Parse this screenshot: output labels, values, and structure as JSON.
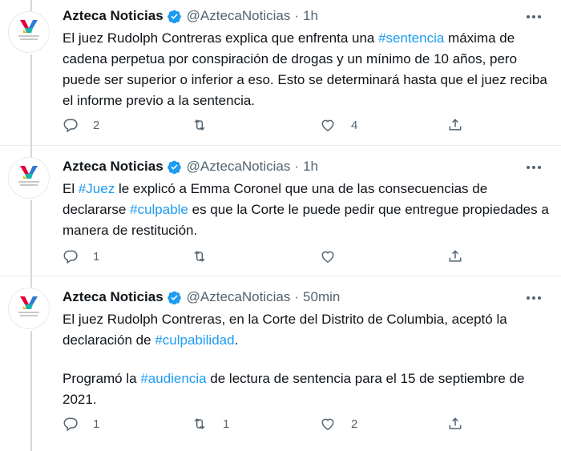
{
  "account": {
    "name": "Azteca Noticias",
    "handle": "@AztecaNoticias",
    "avatar_text": "tv azteca noticias",
    "brand_colors": [
      "#e5003b",
      "#2e7ad1",
      "#f5b400",
      "#19b3a7"
    ],
    "link_color": "#1d9bf0",
    "verified_color": "#1d9bf0"
  },
  "separator": "·",
  "tweets": [
    {
      "time": "1h",
      "segments": [
        {
          "t": "El juez Rudolph Contreras explica que enfrenta una "
        },
        {
          "t": "#sentencia",
          "tag": true
        },
        {
          "t": " máxima de cadena perpetua por conspiración de drogas y un mínimo de 10 años, pero puede ser superior o inferior a eso. Esto se determinará hasta que el juez reciba el informe previo a la sentencia."
        }
      ],
      "replies": "2",
      "retweets": "",
      "likes": "4"
    },
    {
      "time": "1h",
      "segments": [
        {
          "t": "El "
        },
        {
          "t": "#Juez",
          "tag": true
        },
        {
          "t": " le explicó a Emma Coronel que una de las consecuencias de declararse "
        },
        {
          "t": "#culpable",
          "tag": true
        },
        {
          "t": " es que la Corte le puede pedir que entregue propiedades a manera de restitución."
        }
      ],
      "replies": "1",
      "retweets": "",
      "likes": ""
    },
    {
      "time": "50min",
      "paragraph2": [
        {
          "t": "Programó la "
        },
        {
          "t": "#audiencia",
          "tag": true
        },
        {
          "t": " de lectura de sentencia para el 15 de septiembre de 2021."
        }
      ],
      "segments": [
        {
          "t": "El juez Rudolph Contreras, en la Corte del Distrito de Columbia, aceptó la declaración de "
        },
        {
          "t": "#culpabilidad",
          "tag": true
        },
        {
          "t": "."
        }
      ],
      "replies": "1",
      "retweets": "1",
      "likes": "2"
    }
  ],
  "icons": {
    "reply": "reply-icon",
    "retweet": "retweet-icon",
    "like": "heart-icon",
    "share": "share-icon",
    "more": "more-options-icon",
    "verified": "verified-badge-icon"
  }
}
